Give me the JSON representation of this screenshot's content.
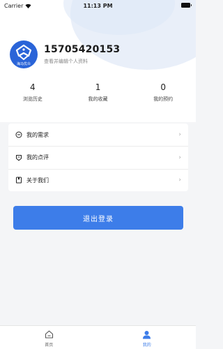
{
  "status_bar": {
    "carrier": "Carrier",
    "time": "11:13 PM"
  },
  "profile": {
    "phone": "15705420153",
    "subtitle": "查看并编辑个人资料",
    "avatar_caption": "海马优众",
    "avatar_icon": "helmet-logo-icon"
  },
  "stats": [
    {
      "value": "4",
      "label": "浏览历史"
    },
    {
      "value": "1",
      "label": "我的收藏"
    },
    {
      "value": "0",
      "label": "我的预约"
    }
  ],
  "menu": [
    {
      "label": "我的需求",
      "icon": "chat-bubble-icon"
    },
    {
      "label": "我的点评",
      "icon": "shield-comment-icon"
    },
    {
      "label": "关于我们",
      "icon": "bookmark-icon"
    }
  ],
  "logout_label": "退出登录",
  "tabs": [
    {
      "label": "首页",
      "icon": "home-icon",
      "active": false
    },
    {
      "label": "我的",
      "icon": "person-icon",
      "active": true
    }
  ],
  "colors": {
    "accent": "#3d7de9",
    "avatar_bg": "#2a64d8",
    "page_bg": "#f4f5f7"
  }
}
